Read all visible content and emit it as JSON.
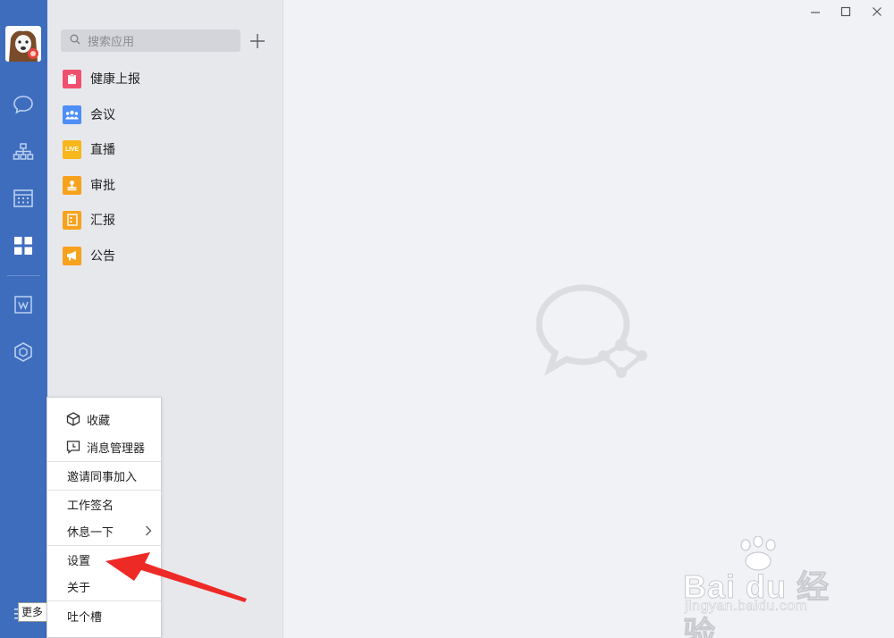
{
  "search": {
    "placeholder": "搜索应用"
  },
  "apps": [
    {
      "label": "健康上报",
      "color": "#f0506e",
      "icon": "health-report-icon"
    },
    {
      "label": "会议",
      "color": "#4e8ef7",
      "icon": "meeting-icon"
    },
    {
      "label": "直播",
      "color": "#f7b619",
      "icon": "live-icon",
      "badge": "LIVE"
    },
    {
      "label": "审批",
      "color": "#f7a21c",
      "icon": "approval-icon"
    },
    {
      "label": "汇报",
      "color": "#f7a21c",
      "icon": "report-icon"
    },
    {
      "label": "公告",
      "color": "#f7a21c",
      "icon": "announcement-icon"
    }
  ],
  "menu": {
    "items": [
      {
        "label": "收藏",
        "icon": "cube-icon"
      },
      {
        "label": "消息管理器",
        "icon": "message-manager-icon"
      },
      {
        "label": "邀请同事加入"
      },
      {
        "label": "工作签名"
      },
      {
        "label": "休息一下",
        "has_submenu": true
      },
      {
        "label": "设置"
      },
      {
        "label": "关于"
      },
      {
        "label": "吐个槽"
      }
    ]
  },
  "rail": {
    "more_tooltip": "更多",
    "icons": [
      "chat-icon",
      "org-chart-icon",
      "calendar-icon",
      "apps-grid-icon",
      "wedoc-icon",
      "workbench-cube-icon"
    ]
  },
  "watermark": {
    "main": "Bai du 经验",
    "sub": "jingyan.baidu.com"
  },
  "colors": {
    "rail": "#3e6dbe",
    "annotation_arrow": "#ee2a27"
  }
}
